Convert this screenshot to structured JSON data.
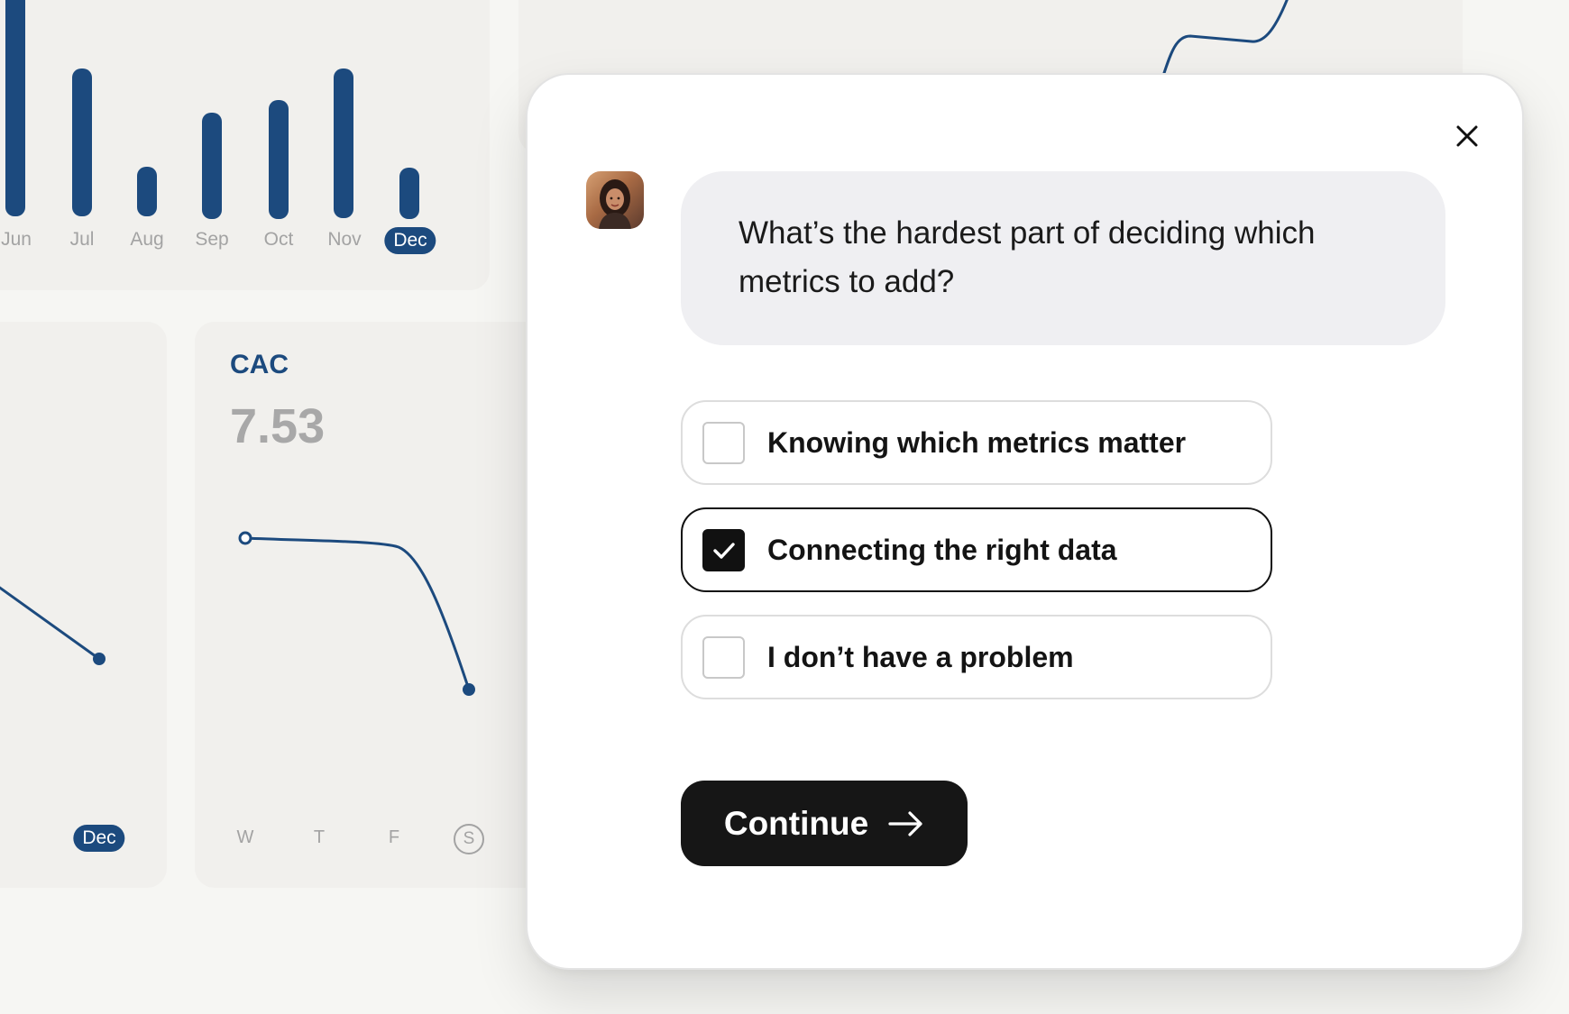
{
  "background": {
    "bar_chart": {
      "months": [
        "Jun",
        "Jul",
        "Aug",
        "Sep",
        "Oct",
        "Nov",
        "Dec"
      ],
      "selected_month": "Dec",
      "bar_color": "#1c4a7e"
    },
    "left_card": {
      "selected_label": "Dec"
    },
    "cac_card": {
      "title": "CAC",
      "value": "7.53",
      "days": [
        "W",
        "T",
        "F",
        "S"
      ]
    }
  },
  "dialog": {
    "question": "What’s the hardest part of deciding which metrics to add?",
    "options": [
      {
        "label": "Knowing which metrics matter",
        "checked": false
      },
      {
        "label": "Connecting the right data",
        "checked": true
      },
      {
        "label": "I don’t have a problem",
        "checked": false
      }
    ],
    "continue_label": "Continue",
    "icons": {
      "close": "close-icon",
      "arrow": "arrow-right-icon",
      "check": "check-icon"
    }
  }
}
